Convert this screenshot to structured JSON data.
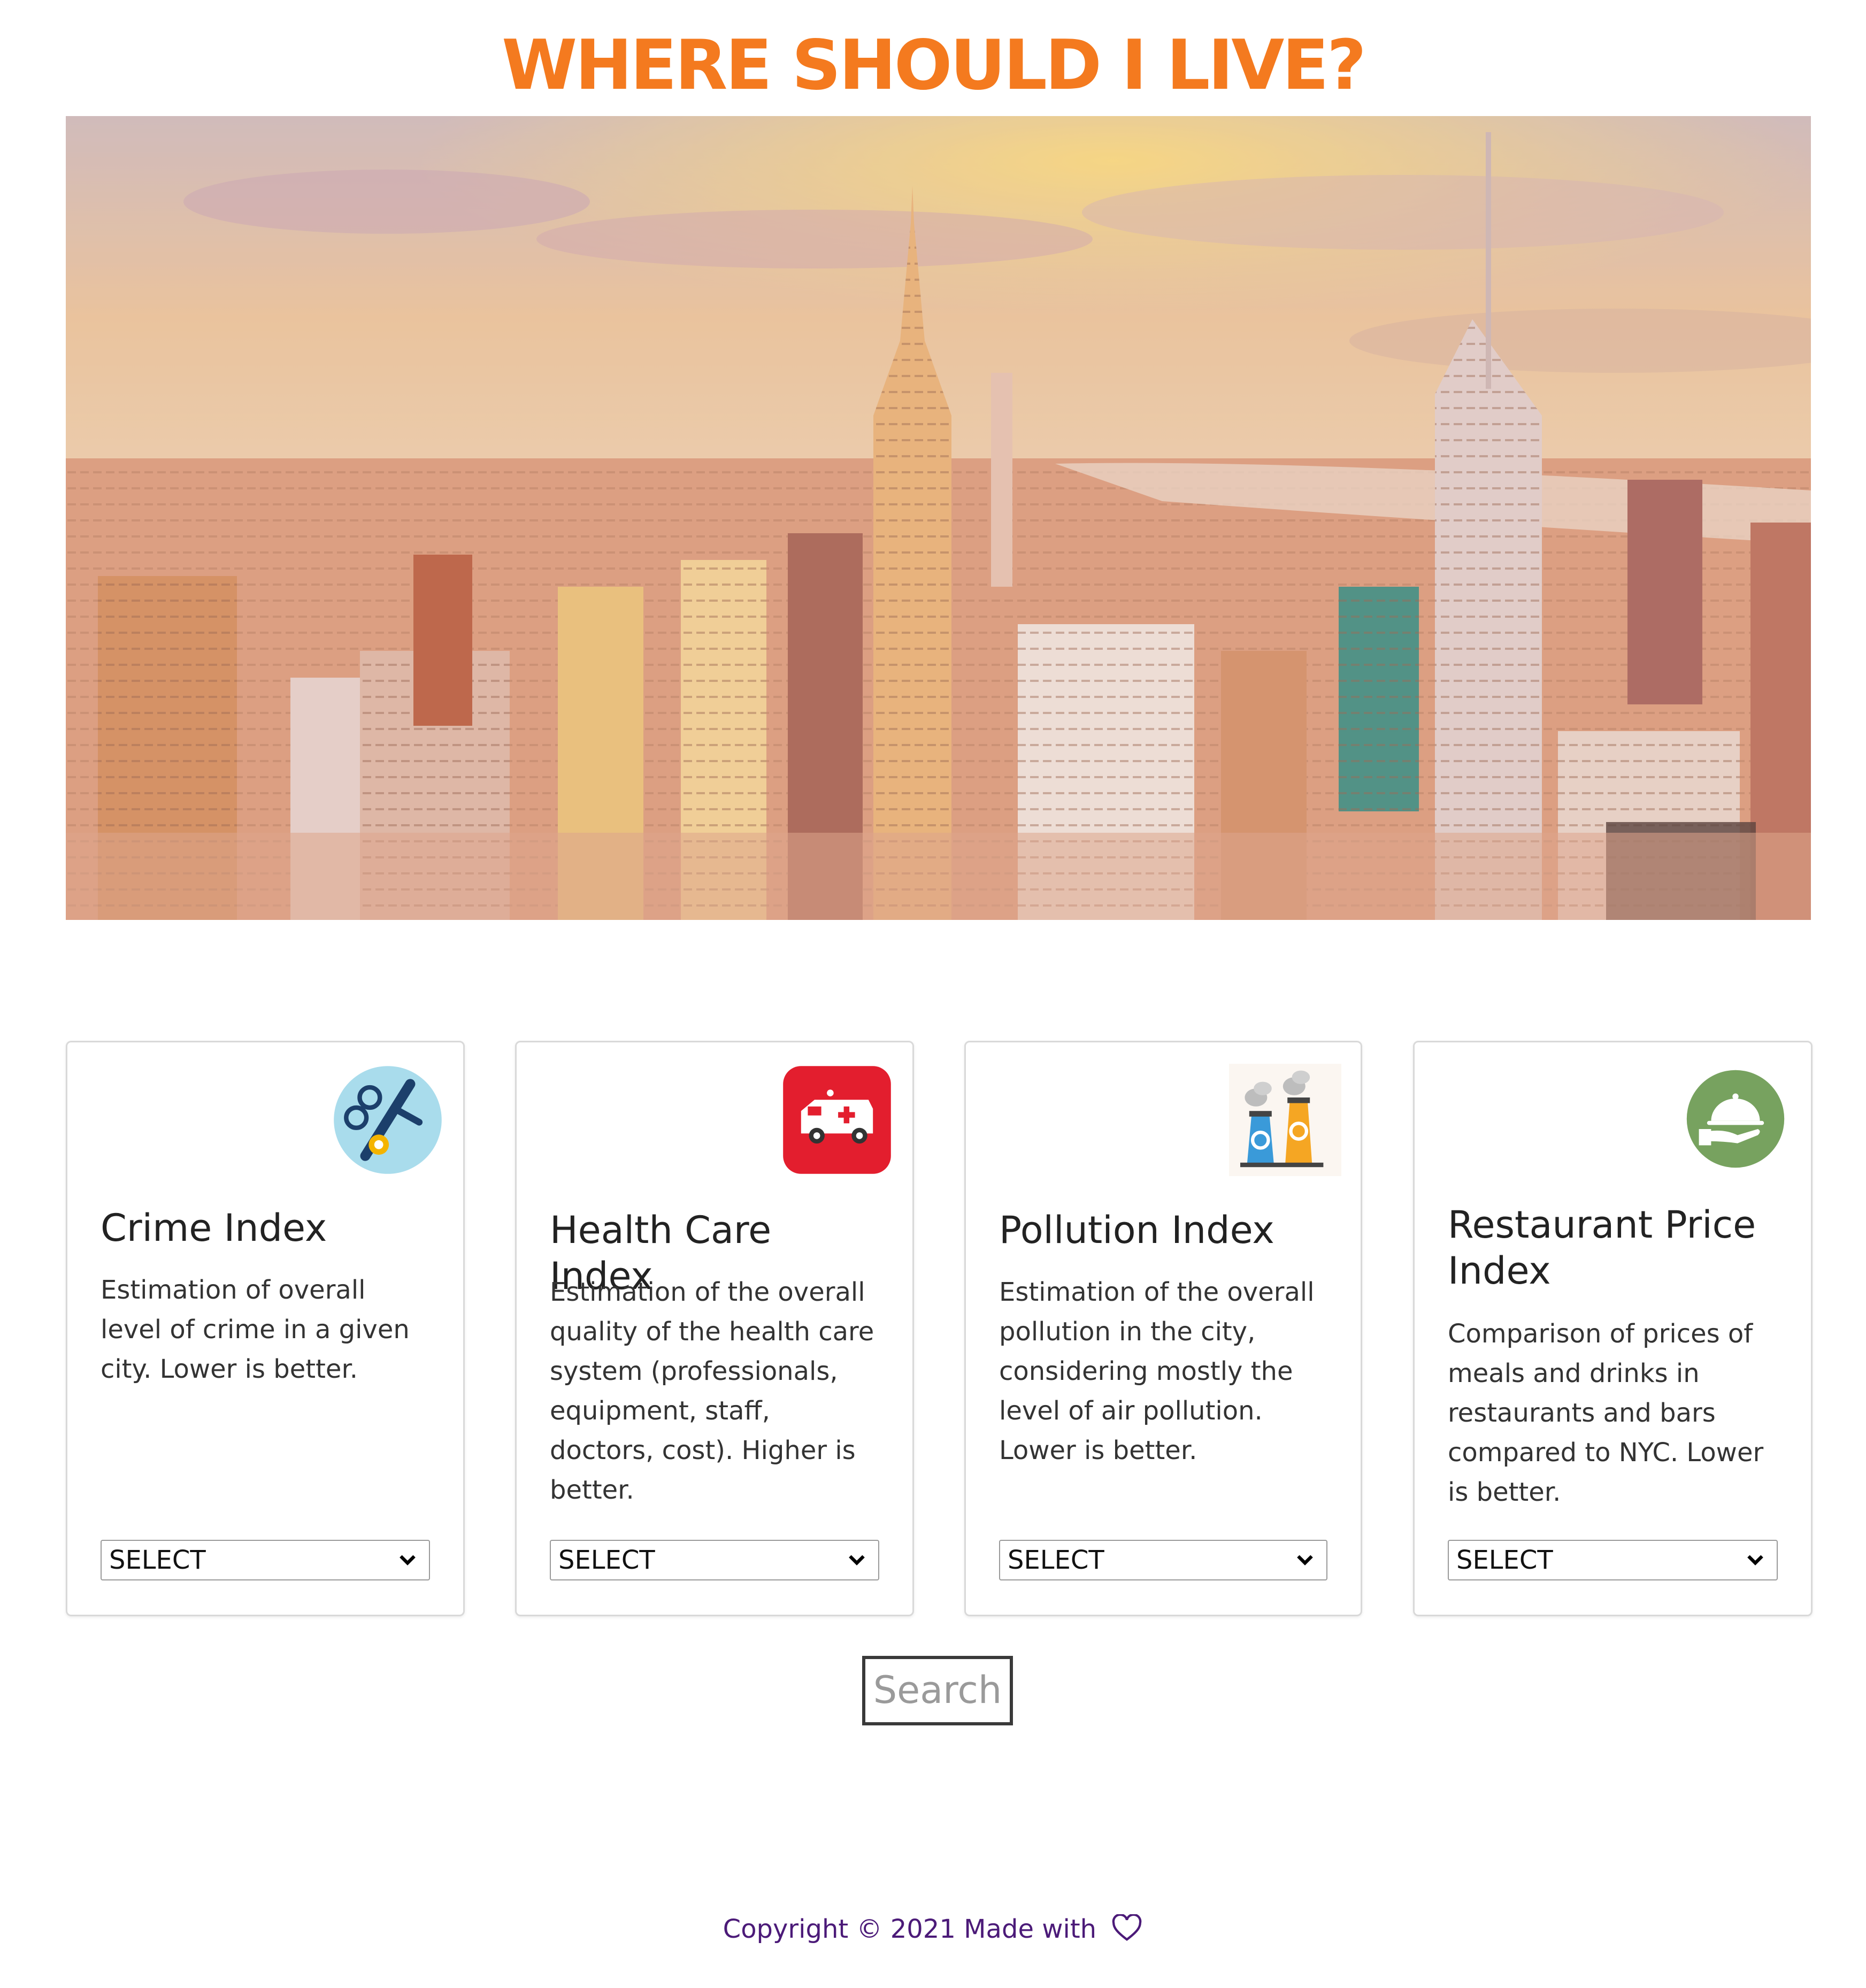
{
  "header": {
    "title": "WHERE SHOULD I LIVE?"
  },
  "hero": {
    "image": "city-skyline-image"
  },
  "cards": [
    {
      "title": "Crime Index",
      "description": "Estimation of overall level of crime in a given city. Lower is better.",
      "select_value": "SELECT",
      "icon": "handcuffs-badge-icon"
    },
    {
      "title": "Health Care Index",
      "description": "Estimation of the overall quality of the health care system (professionals, equipment, staff, doctors, cost). Higher is better.",
      "select_value": "SELECT",
      "icon": "ambulance-icon"
    },
    {
      "title": "Pollution Index",
      "description": "Estimation of the overall pollution in the city, considering mostly the level of air pollution. Lower is better.",
      "select_value": "SELECT",
      "icon": "factory-chimney-icon"
    },
    {
      "title": "Restaurant Price Index",
      "description": "Comparison of prices of meals and drinks in restaurants and bars compared to NYC. Lower is better.",
      "select_value": "SELECT",
      "icon": "food-cloche-icon"
    }
  ],
  "search": {
    "label": "Search"
  },
  "footer": {
    "text": "Copyright © 2021 Made with"
  },
  "colors": {
    "title": "#f47a1f",
    "footer": "#4b1a78",
    "ambulance_red": "#e31e2e",
    "cloche_green": "#77a25f",
    "crime_blue": "#a9dcec"
  }
}
